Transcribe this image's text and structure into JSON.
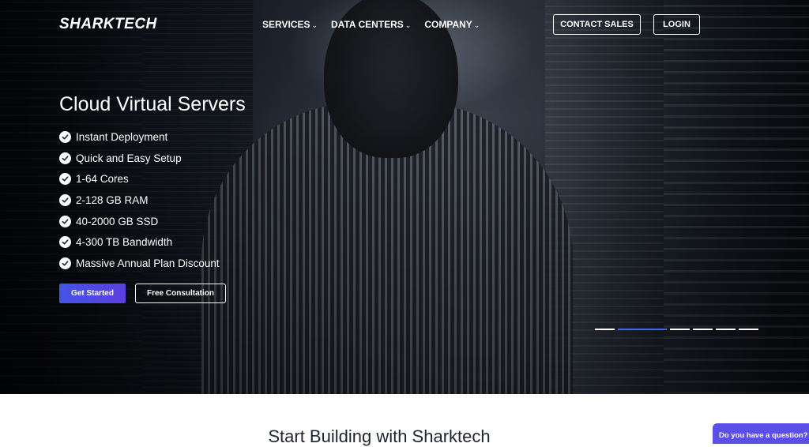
{
  "header": {
    "logo_text": "SHARKTECH",
    "nav": [
      {
        "label": "SERVICES"
      },
      {
        "label": "DATA CENTERS"
      },
      {
        "label": "COMPANY"
      }
    ],
    "contact_sales_label": "CONTACT SALES",
    "login_label": "LOGIN"
  },
  "hero": {
    "title": "Cloud Virtual Servers",
    "features": [
      "Instant Deployment",
      "Quick and Easy Setup",
      "1-64 Cores",
      "2-128 GB RAM",
      "40-2000 GB SSD",
      "4-300 TB Bandwidth",
      "Massive Annual Plan Discount"
    ],
    "primary_cta": "Get Started",
    "secondary_cta": "Free Consultation",
    "slider": {
      "total": 6,
      "active_index": 1
    }
  },
  "section": {
    "title": "Start Building with Sharktech"
  },
  "chat": {
    "label": "Do you have a question?"
  },
  "colors": {
    "accent": "#4c5fe8",
    "chat_bg": "#5b4fe9",
    "hero_dark": "#161c26",
    "text_dark": "#1f2430"
  }
}
